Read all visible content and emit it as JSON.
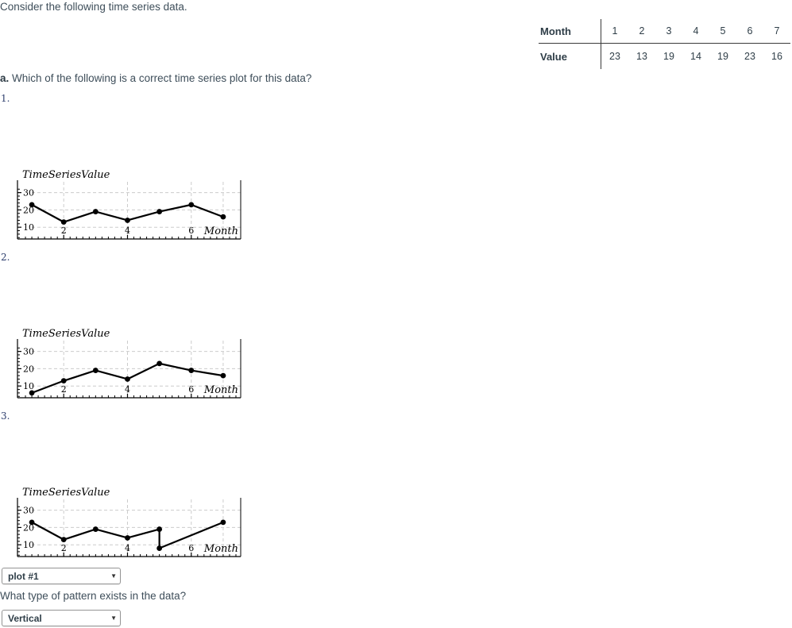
{
  "prompt": {
    "intro": "Consider the following time series data.",
    "part_a_marker": "a.",
    "part_a_question": "Which of the following is a correct time series plot for this data?",
    "pattern_question": "What type of pattern exists in the data?"
  },
  "table": {
    "row_labels": [
      "Month",
      "Value"
    ],
    "months": [
      "1",
      "2",
      "3",
      "4",
      "5",
      "6",
      "7"
    ],
    "values": [
      "23",
      "13",
      "19",
      "14",
      "19",
      "23",
      "16"
    ]
  },
  "plot_options": {
    "labels": [
      "1.",
      "2.",
      "3."
    ]
  },
  "answers": {
    "plot_select_value": "plot #1",
    "pattern_select_value": "Vertical",
    "arrow_glyph": "▼"
  },
  "colors": {
    "text": "#3e4e5a",
    "index_label": "#2e3f6e",
    "axis": "#000000",
    "gridline": "#cccccc",
    "series": "#000000"
  },
  "chart_data": [
    {
      "type": "line",
      "title": "",
      "xlabel": "Month",
      "ylabel": "TimeSeriesValue",
      "x": [
        1,
        2,
        3,
        4,
        5,
        6,
        7
      ],
      "values": [
        23,
        13,
        19,
        14,
        19,
        23,
        16
      ],
      "xlim": [
        0.55,
        7.55
      ],
      "ylim": [
        3.2,
        33.5
      ],
      "xticks": [
        2,
        4,
        6
      ],
      "yticks": [
        10,
        20,
        30
      ],
      "grid": true,
      "markers": true,
      "legend": "none"
    },
    {
      "type": "line",
      "title": "",
      "xlabel": "Month",
      "ylabel": "TimeSeriesValue",
      "x": [
        1,
        2,
        3,
        4,
        5,
        6,
        7
      ],
      "values": [
        6,
        13,
        19,
        14,
        23,
        19,
        16
      ],
      "xlim": [
        0.55,
        7.55
      ],
      "ylim": [
        3.2,
        33.5
      ],
      "xticks": [
        2,
        4,
        6
      ],
      "yticks": [
        10,
        20,
        30
      ],
      "grid": true,
      "markers": true,
      "legend": "none"
    },
    {
      "type": "line",
      "title": "",
      "xlabel": "Month",
      "ylabel": "TimeSeriesValue",
      "x": [
        1,
        2,
        3,
        4,
        5,
        5,
        7
      ],
      "values": [
        23,
        13,
        19,
        14,
        19,
        8,
        23
      ],
      "xlim": [
        0.55,
        7.55
      ],
      "ylim": [
        3.2,
        33.5
      ],
      "xticks": [
        2,
        4,
        6
      ],
      "yticks": [
        10,
        20,
        30
      ],
      "grid": true,
      "markers": true,
      "legend": "none"
    }
  ]
}
